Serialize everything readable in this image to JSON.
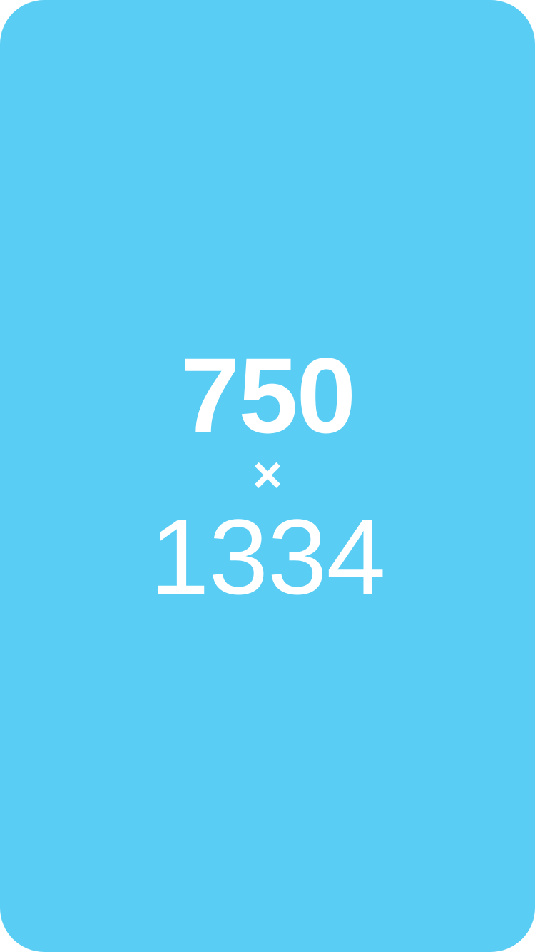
{
  "placeholder": {
    "width_label": "750",
    "separator": "×",
    "height_label": "1334",
    "background_color": "#59CDF4",
    "text_color": "#FFFFFF"
  }
}
